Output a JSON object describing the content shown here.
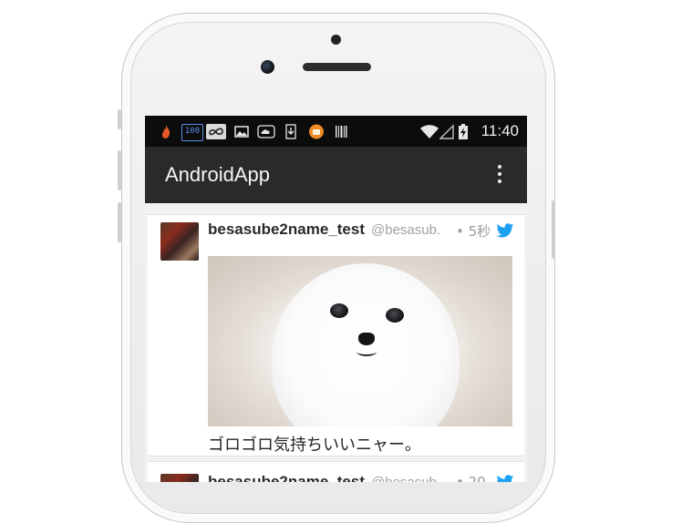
{
  "status_bar": {
    "time": "11:40",
    "notification_icons": [
      "fire-icon",
      "battery-percent-icon",
      "infinity-icon",
      "image-icon",
      "cloud-icon",
      "download-icon",
      "orange-app-icon",
      "barcode-icon"
    ],
    "battery_badge": "100",
    "system_icons": [
      "wifi-icon",
      "cell-signal-icon",
      "battery-charging-icon"
    ]
  },
  "app_bar": {
    "title": "AndroidApp",
    "menu_icon": "overflow-menu-icon"
  },
  "tweets": [
    {
      "username": "besasube2name_test",
      "handle": "@besasub.",
      "time": "• 5秒",
      "text": "ゴロゴロ気持ちいいニャー。",
      "media": "white-pomeranian-photo",
      "source_icon": "twitter-bird-icon"
    },
    {
      "username": "besasube2name_test",
      "handle": "@besasub.",
      "time": "• 20",
      "text": "",
      "source_icon": "twitter-bird-icon"
    }
  ],
  "colors": {
    "status_bar_bg": "#0c0c0c",
    "app_bar_bg": "#2a2a2a",
    "twitter_blue": "#1da1f2",
    "feed_bg": "#f2f2f2"
  }
}
